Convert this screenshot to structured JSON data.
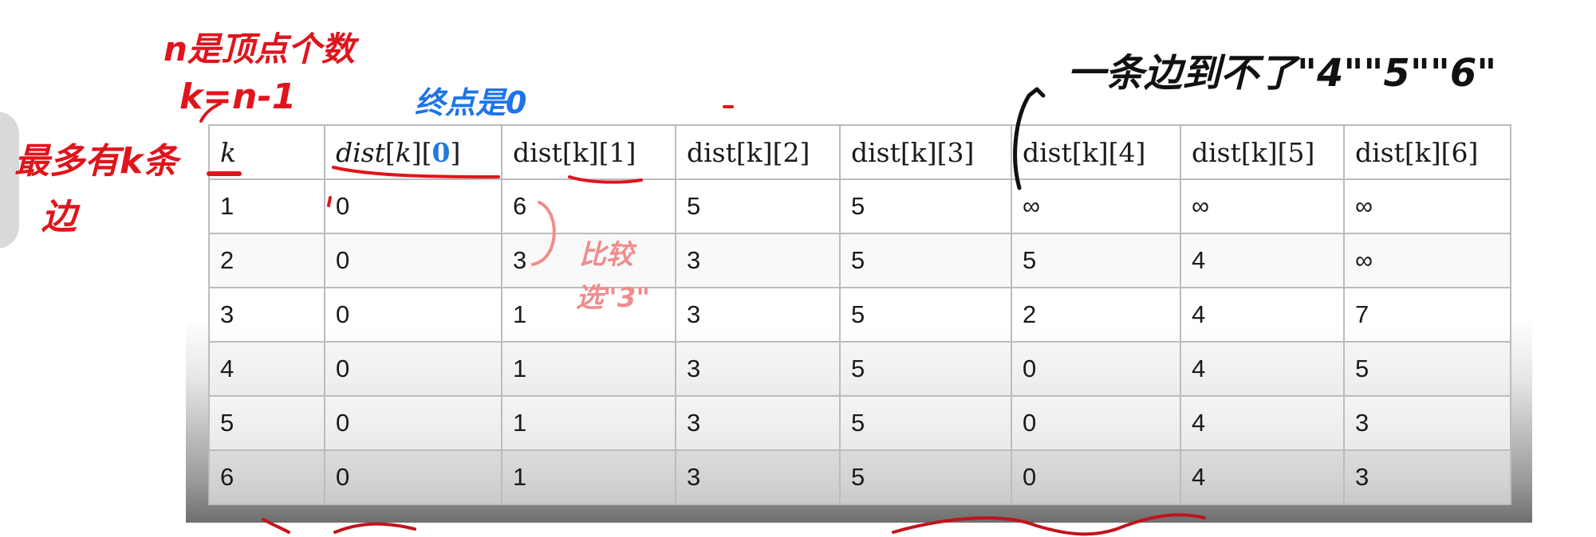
{
  "table": {
    "headers": [
      "k",
      "dist[k][0]",
      "dist[k][1]",
      "dist[k][2]",
      "dist[k][3]",
      "dist[k][4]",
      "dist[k][5]",
      "dist[k][6]"
    ],
    "rows": [
      [
        "1",
        "0",
        "6",
        "5",
        "5",
        "∞",
        "∞",
        "∞"
      ],
      [
        "2",
        "0",
        "3",
        "3",
        "5",
        "5",
        "4",
        "∞"
      ],
      [
        "3",
        "0",
        "1",
        "3",
        "5",
        "2",
        "4",
        "7"
      ],
      [
        "4",
        "0",
        "1",
        "3",
        "5",
        "0",
        "4",
        "5"
      ],
      [
        "5",
        "0",
        "1",
        "3",
        "5",
        "0",
        "4",
        "3"
      ],
      [
        "6",
        "0",
        "1",
        "3",
        "5",
        "0",
        "4",
        "3"
      ]
    ]
  },
  "annotations": {
    "n_note": "n是顶点个数",
    "k_formula": "k=n-1",
    "max_k_edges_line1": "最多有k条",
    "max_k_edges_line2": "边",
    "start_point": "终点是0",
    "unreachable": "一条边到不了\"4\"\"5\"\"6\"",
    "compare_line1": "比较",
    "compare_line2": "选\"3\""
  },
  "colors": {
    "red_ink": "#e0141c",
    "blue_ink": "#1e74e8",
    "pink_ink": "#f08c8c",
    "black_ink": "#111111"
  }
}
